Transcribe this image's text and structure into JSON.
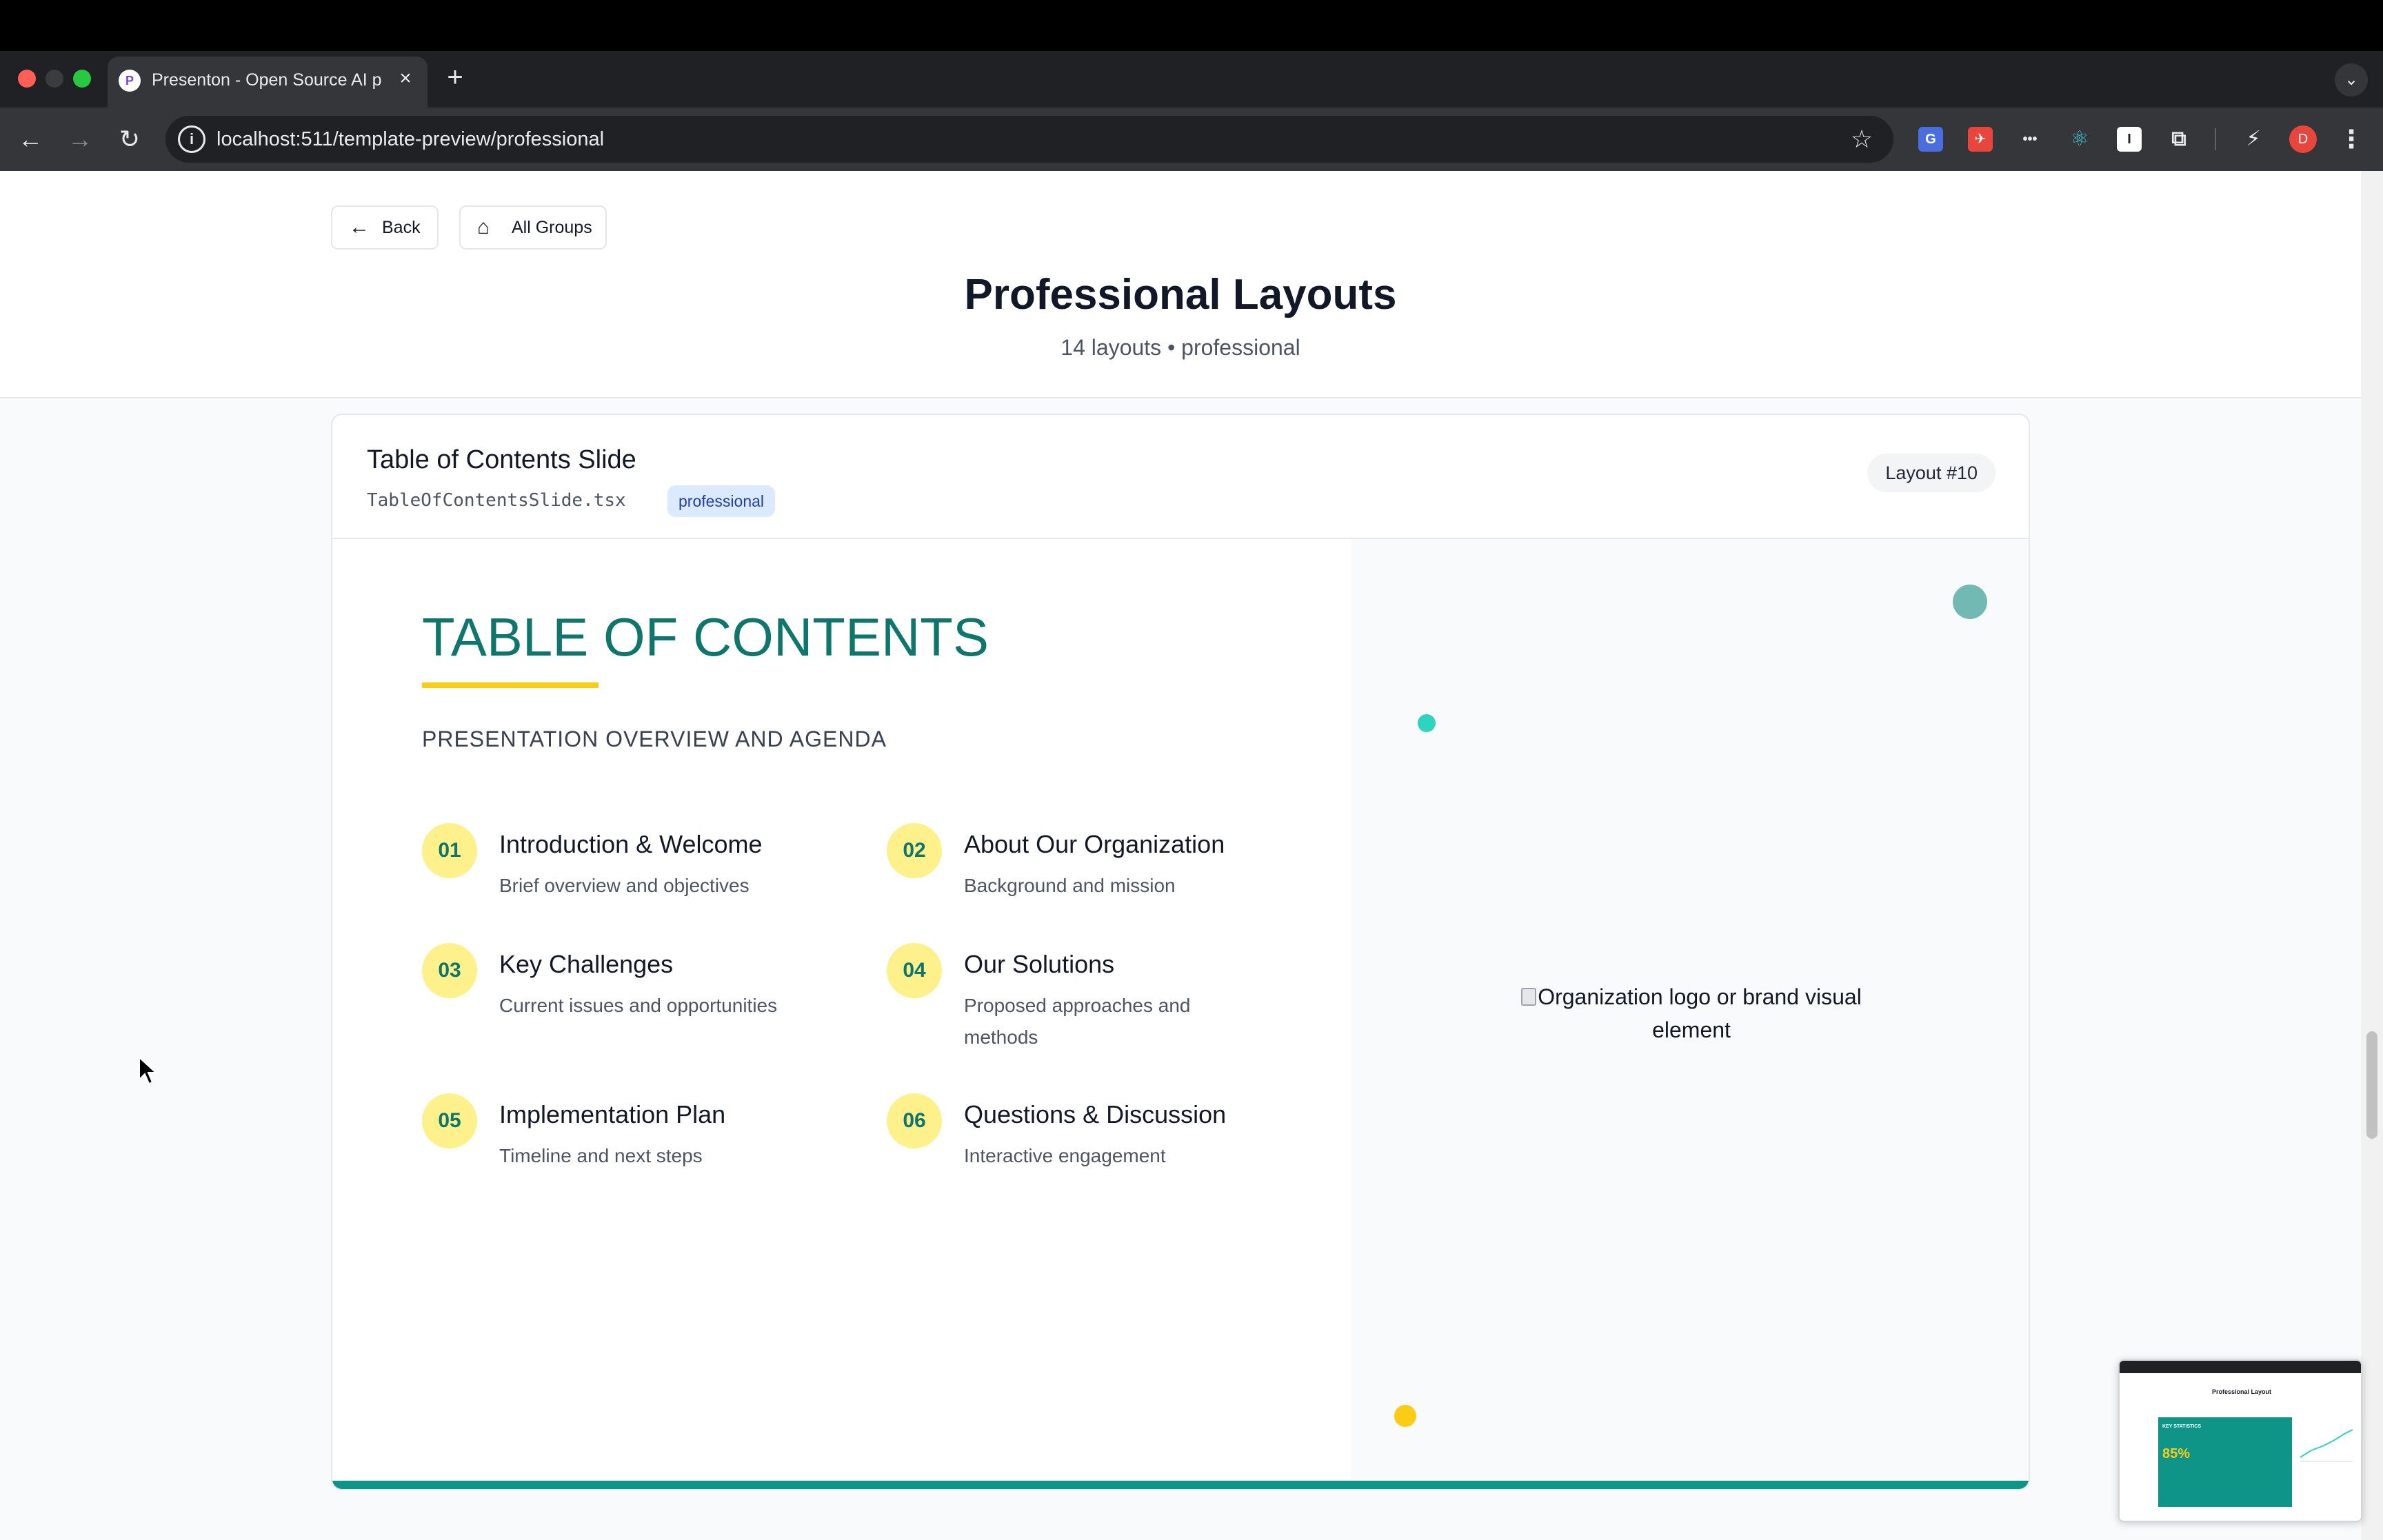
{
  "browser": {
    "tab_title": "Presenton - Open Source AI p",
    "tab_favicon": "P",
    "url": "localhost:511/template-preview/professional",
    "profile_initial": "D",
    "icons": [
      "back-arrow-icon",
      "forward-arrow-icon",
      "reload-icon",
      "site-info-icon",
      "bookmark-star-icon",
      "extensions-puzzle-icon",
      "more-menu-icon"
    ]
  },
  "header": {
    "back_label": "Back",
    "all_groups_label": "All Groups",
    "title": "Professional Layouts",
    "subtitle": "14 layouts • professional"
  },
  "card": {
    "title": "Table of Contents Slide",
    "file": "TableOfContentsSlide.tsx",
    "tag": "professional",
    "layout_badge": "Layout #10"
  },
  "slide": {
    "heading": "TABLE OF CONTENTS",
    "subheading": "PRESENTATION OVERVIEW AND AGENDA",
    "items": [
      {
        "num": "01",
        "title": "Introduction & Welcome",
        "desc": "Brief overview and objectives"
      },
      {
        "num": "02",
        "title": "About Our Organization",
        "desc": "Background and mission"
      },
      {
        "num": "03",
        "title": "Key Challenges",
        "desc": "Current issues and opportunities"
      },
      {
        "num": "04",
        "title": "Our Solutions",
        "desc": "Proposed approaches and methods"
      },
      {
        "num": "05",
        "title": "Implementation Plan",
        "desc": "Timeline and next steps"
      },
      {
        "num": "06",
        "title": "Questions & Discussion",
        "desc": "Interactive engagement"
      }
    ],
    "image_alt": "Organization logo or brand visual element",
    "colors": {
      "primary": "#0f766e",
      "accent": "#facc15",
      "number_bg": "#fef08a",
      "bottom_bar": "#0f9488"
    }
  },
  "pip_preview": {
    "title": "Professional Layout",
    "slide_heading": "KEY STATISTICS",
    "big_value": "85%"
  }
}
